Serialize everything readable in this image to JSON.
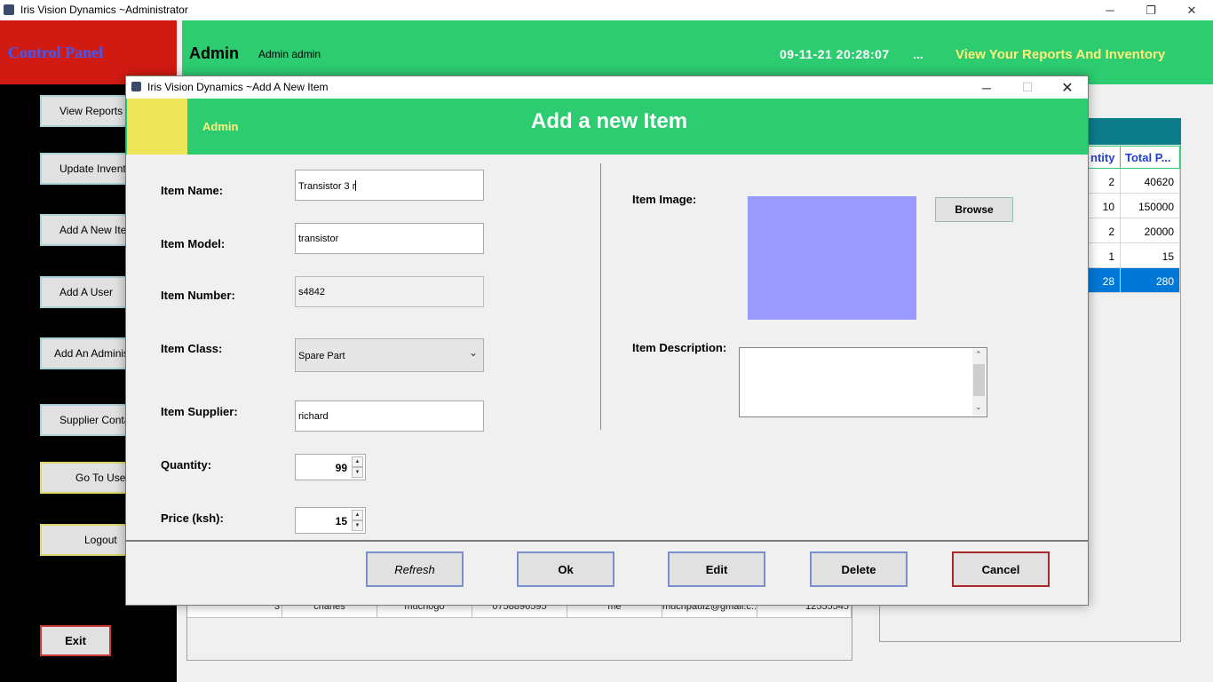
{
  "window": {
    "title": "Iris Vision Dynamics ~Administrator",
    "controls": {
      "minimize": "─",
      "restore": "❐",
      "close": "✕"
    }
  },
  "control_panel": {
    "title": "Control Panel",
    "buttons": [
      "View Reports",
      "Update Inventory",
      "Add A New Item",
      "Add A User",
      "Add An Administrator",
      "Supplier Contacts",
      "Go To User",
      "Logout"
    ],
    "exit": "Exit"
  },
  "header": {
    "role": "Admin",
    "user_name": "Admin admin",
    "datetime": "09-11-21  20:28:07",
    "ellipsis": "...",
    "tagline": "View Your Reports And Inventory"
  },
  "inventory_table": {
    "columns": [
      "ntity",
      "Total P..."
    ],
    "rows": [
      [
        "2",
        "40620"
      ],
      [
        "10",
        "150000"
      ],
      [
        "2",
        "20000"
      ],
      [
        "1",
        "15"
      ],
      [
        "28",
        "280"
      ]
    ],
    "selected_row": 4
  },
  "user_table": {
    "row": [
      "3",
      "charles",
      "muchogo",
      "0758896595",
      "me",
      "muchpaul2@gmail.c...",
      "12555545"
    ]
  },
  "dialog": {
    "title": "Iris Vision Dynamics ~Add A New Item",
    "controls": {
      "minimize": "─",
      "maximize": "☐",
      "close": "✕"
    },
    "header_user": "Admin",
    "header_title": "Add a new Item",
    "fields": {
      "item_name": {
        "label": "Item Name:",
        "value": "Transistor 3 r"
      },
      "item_model": {
        "label": "Item Model:",
        "value": "transistor"
      },
      "item_number": {
        "label": "Item Number:",
        "value": "s4842"
      },
      "item_class": {
        "label": "Item Class:",
        "value": "Spare Part"
      },
      "item_supplier": {
        "label": "Item Supplier:",
        "value": "richard"
      },
      "quantity": {
        "label": "Quantity:",
        "value": "99"
      },
      "price": {
        "label": "Price (ksh):",
        "value": "15"
      },
      "item_image": {
        "label": "Item Image:"
      },
      "item_description": {
        "label": "Item Description:",
        "value": ""
      }
    },
    "image_placeholder_color": "#9999ff",
    "browse": "Browse",
    "actions": {
      "refresh": "Refresh",
      "ok": "Ok",
      "edit": "Edit",
      "delete": "Delete",
      "cancel": "Cancel"
    }
  },
  "colors": {
    "header_green": "#2ecc71",
    "control_panel_red": "#d11a12",
    "control_panel_text": "#3b5bff",
    "highlight_yellow": "#fff07a",
    "selection_blue": "#0078d7",
    "table_header_blue": "#1f3fd6"
  }
}
